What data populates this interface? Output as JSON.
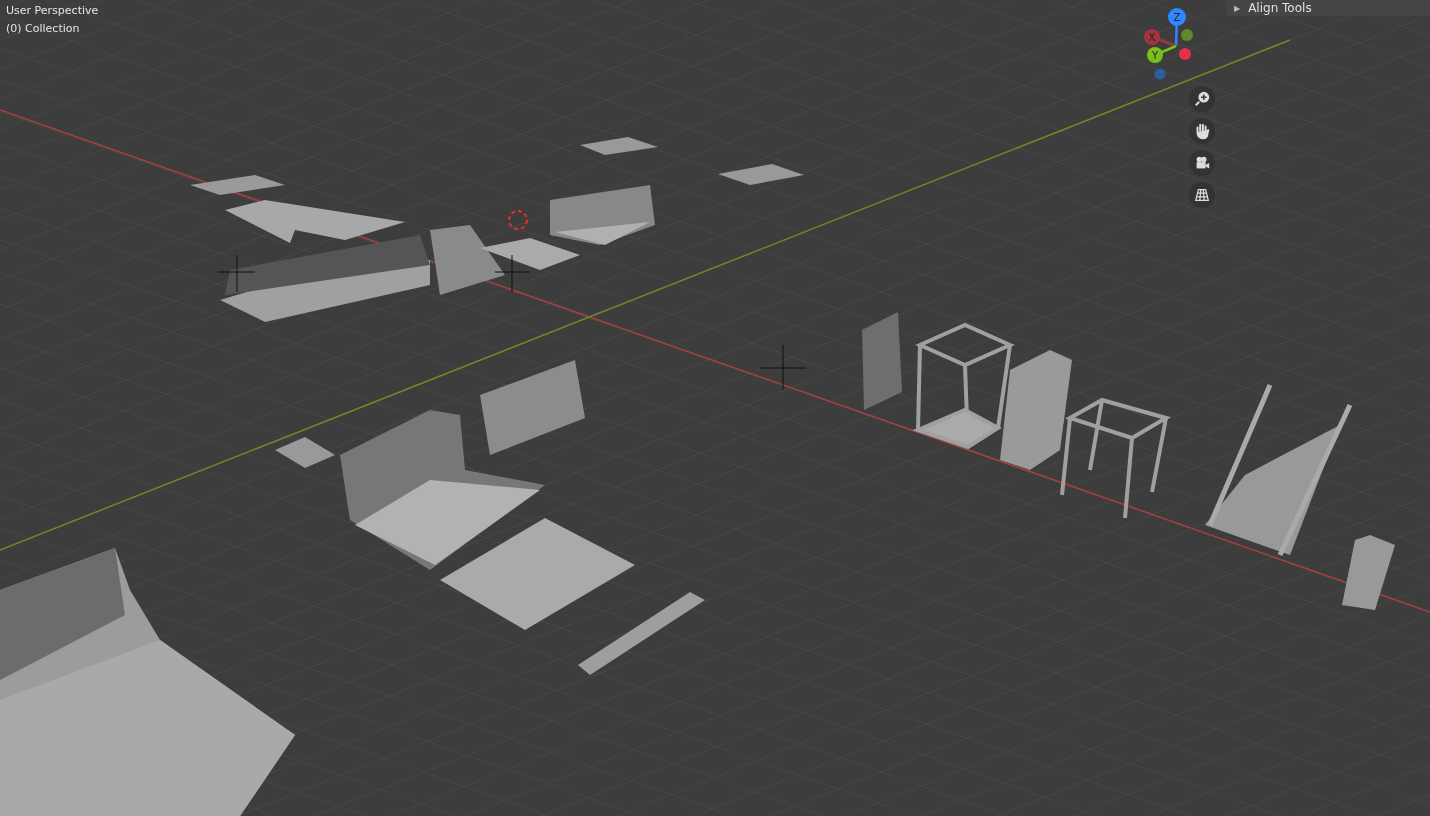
{
  "viewport": {
    "view_name": "User Perspective",
    "collection": "(0) Collection"
  },
  "panel": {
    "expander": "▶",
    "label": "Align Tools"
  },
  "gizmo": {
    "axes": [
      {
        "label": "Z",
        "color": "#2f86ff"
      },
      {
        "label": "X",
        "color": "#a3353f"
      },
      {
        "label": "Y",
        "color": "#7ac01a"
      }
    ]
  }
}
